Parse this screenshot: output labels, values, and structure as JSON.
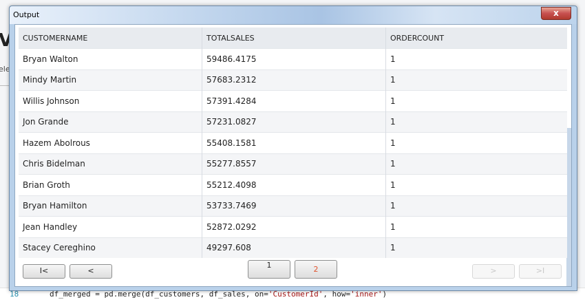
{
  "background": {
    "title_fragment": "Vi",
    "small_text": "elec",
    "line_number": "18",
    "code": {
      "part1": "df_merged = pd.merge(df_customers, df_sales, on=",
      "str1": "'CustomerId'",
      "part2": ", how=",
      "str2": "'inner'",
      "part3": ")"
    }
  },
  "dialog": {
    "title": "Output",
    "close_label": "x"
  },
  "table": {
    "headers": [
      "CUSTOMERNAME",
      "TOTALSALES",
      "ORDERCOUNT"
    ],
    "rows": [
      [
        "Bryan Walton",
        "59486.4175",
        "1"
      ],
      [
        "Mindy Martin",
        "57683.2312",
        "1"
      ],
      [
        "Willis Johnson",
        "57391.4284",
        "1"
      ],
      [
        "Jon Grande",
        "57231.0827",
        "1"
      ],
      [
        "Hazem Abolrous",
        "55408.1581",
        "1"
      ],
      [
        "Chris Bidelman",
        "55277.8557",
        "1"
      ],
      [
        "Brian Groth",
        "55212.4098",
        "1"
      ],
      [
        "Bryan Hamilton",
        "53733.7469",
        "1"
      ],
      [
        "Jean Handley",
        "52872.0292",
        "1"
      ],
      [
        "Stacey Cereghino",
        "49297.608",
        "1"
      ]
    ]
  },
  "pager": {
    "first_label": "I<",
    "prev_label": "<",
    "page1_label": "1",
    "page2_label": "2",
    "next_label": ">",
    "last_label": ">I",
    "accent_color": "#e0532e"
  }
}
